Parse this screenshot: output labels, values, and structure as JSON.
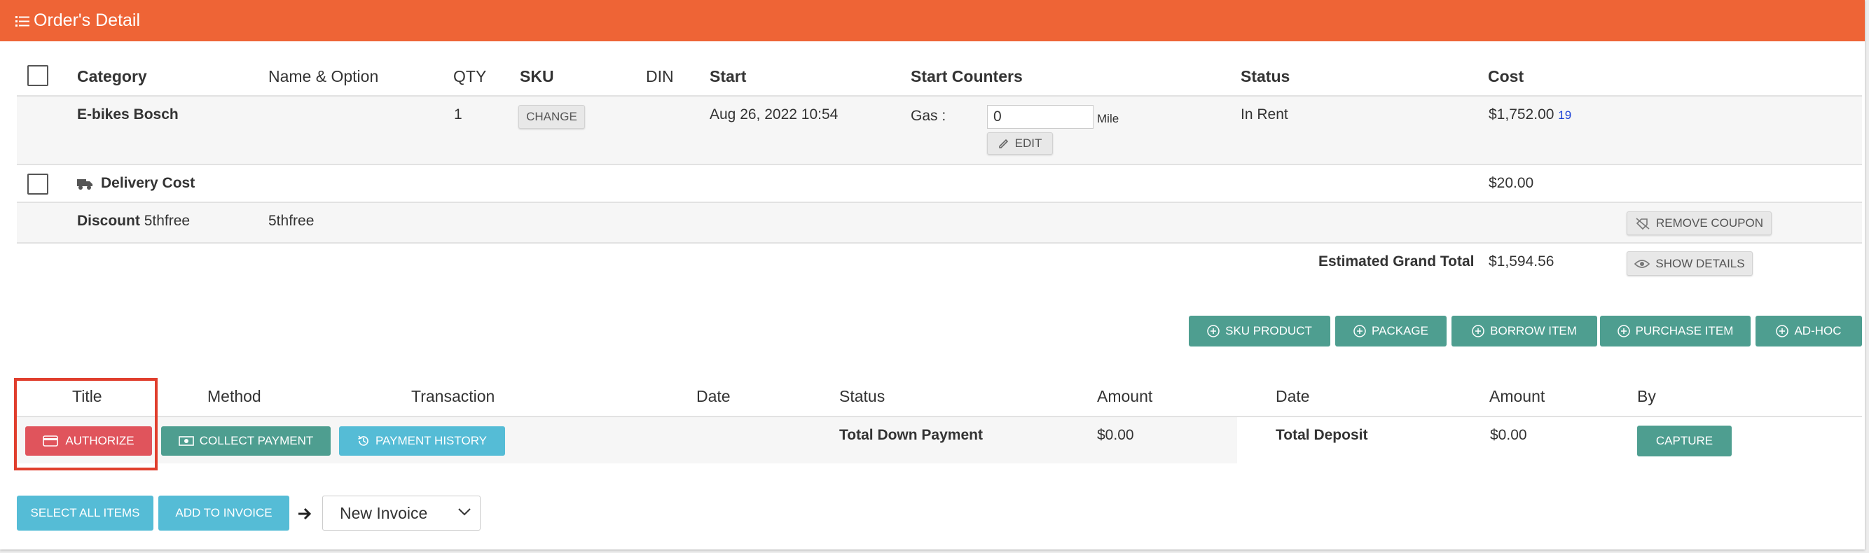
{
  "header": {
    "title": "Order's Detail"
  },
  "items_table": {
    "columns": [
      "Category",
      "Name & Option",
      "QTY",
      "SKU",
      "DIN",
      "Start",
      "Start Counters",
      "Status",
      "Cost"
    ],
    "row1": {
      "category": "E-bikes Bosch",
      "qty": "1",
      "sku_button": "CHANGE",
      "start": "Aug 26, 2022 10:54",
      "counter_label": "Gas :",
      "counter_value": "0",
      "counter_unit": "Mile",
      "edit_button": "EDIT",
      "status": "In Rent",
      "cost": "$1,752.00",
      "cost_link": "19"
    },
    "delivery": {
      "label": "Delivery Cost",
      "cost": "$20.00"
    },
    "discount": {
      "label": "Discount",
      "code": "5thfree",
      "name": "5thfree",
      "remove_button": "REMOVE COUPON"
    },
    "total": {
      "label": "Estimated Grand Total",
      "value": "$1,594.56",
      "details_button": "SHOW DETAILS"
    }
  },
  "add_buttons": [
    "SKU PRODUCT",
    "PACKAGE",
    "BORROW ITEM",
    "PURCHASE ITEM",
    "AD-HOC"
  ],
  "payments": {
    "columns": [
      "Title",
      "Method",
      "Transaction",
      "Date",
      "Status",
      "Amount"
    ],
    "authorize": "AUTHORIZE",
    "collect": "COLLECT PAYMENT",
    "history": "PAYMENT HISTORY",
    "total_label": "Total Down Payment",
    "total_value": "$0.00"
  },
  "deposits": {
    "columns": [
      "Date",
      "Amount",
      "By"
    ],
    "total_label": "Total Deposit",
    "total_value": "$0.00",
    "capture": "CAPTURE"
  },
  "footer": {
    "select_all": "SELECT ALL ITEMS",
    "add_invoice": "ADD TO INVOICE",
    "invoice_select": "New Invoice"
  },
  "colors": {
    "header": "#ee6436",
    "teal": "#4e9e90",
    "cyan": "#55bcd6",
    "red": "#e0545c",
    "highlight": "#e03e2d"
  }
}
